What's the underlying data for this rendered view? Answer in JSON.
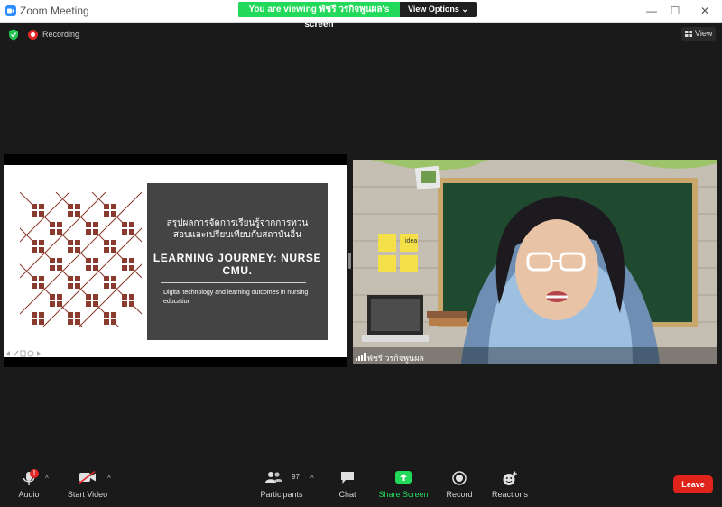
{
  "window": {
    "title": "Zoom Meeting",
    "controls": {
      "minimize": "—",
      "maximize": "☐",
      "close": "✕"
    }
  },
  "share_banner": {
    "message": "You are viewing พัชรี วรกิจพูนผล's screen",
    "view_options": "View Options ⌄"
  },
  "topbar": {
    "recording_label": "Recording",
    "view_label": "View"
  },
  "slide": {
    "thai_title_line1": "สรุปผลการจัดการเรียนรู้จากการทวน",
    "thai_title_line2": "สอบและเปรียบเทียบกับสถาบันอื่น",
    "main_title": "LEARNING JOURNEY: NURSE CMU.",
    "subtitle": "Digital technology and learning outcomes in nursing education"
  },
  "video": {
    "participant_name": "พัชรี วรกิจพูนผล",
    "sticky_notes": [
      "idea"
    ]
  },
  "toolbar": {
    "audio_label": "Audio",
    "audio_badge": "!",
    "video_label": "Start Video",
    "participants_label": "Participants",
    "participants_count": "97",
    "chat_label": "Chat",
    "share_label": "Share Screen",
    "record_label": "Record",
    "reactions_label": "Reactions",
    "leave_label": "Leave"
  },
  "colors": {
    "accent_blue": "#2d8cff",
    "share_green": "#23d959",
    "leave_red": "#e0241b",
    "recording_red": "#e02828",
    "slide_panel": "#444444",
    "pattern_brown": "#8b3a2e"
  },
  "icons": [
    "zoom-logo-icon",
    "shield-check-icon",
    "recording-icon",
    "grid-view-icon",
    "microphone-icon",
    "video-off-icon",
    "participants-icon",
    "chat-icon",
    "share-screen-icon",
    "record-icon",
    "reactions-icon",
    "signal-icon"
  ]
}
